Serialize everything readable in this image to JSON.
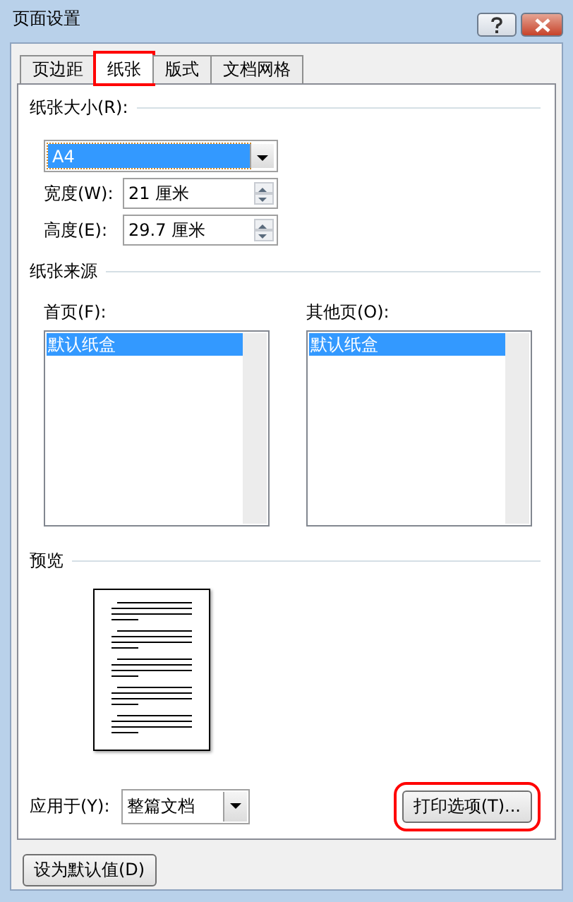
{
  "window": {
    "title": "页面设置"
  },
  "tabs": [
    {
      "label": "页边距",
      "selected": false,
      "highlighted": false
    },
    {
      "label": "纸张",
      "selected": true,
      "highlighted": true
    },
    {
      "label": "版式",
      "selected": false,
      "highlighted": false
    },
    {
      "label": "文档网格",
      "selected": false,
      "highlighted": false
    }
  ],
  "paper_size": {
    "heading": "纸张大小(R):",
    "value": "A4",
    "width_label": "宽度(W):",
    "width_value": "21 厘米",
    "height_label": "高度(E):",
    "height_value": "29.7 厘米"
  },
  "paper_source": {
    "heading": "纸张来源",
    "lists": [
      {
        "label": "首页(F):",
        "items": [
          {
            "text": "默认纸盒",
            "selected": true
          }
        ]
      },
      {
        "label": "其他页(O):",
        "items": [
          {
            "text": "默认纸盒",
            "selected": true
          }
        ]
      }
    ]
  },
  "preview": {
    "heading": "预览"
  },
  "apply_to": {
    "label": "应用于(Y):",
    "value": "整篇文档"
  },
  "print_options_button": {
    "label": "打印选项(T)...",
    "highlighted": true
  },
  "default_button": {
    "label": "设为默认值(D)"
  }
}
